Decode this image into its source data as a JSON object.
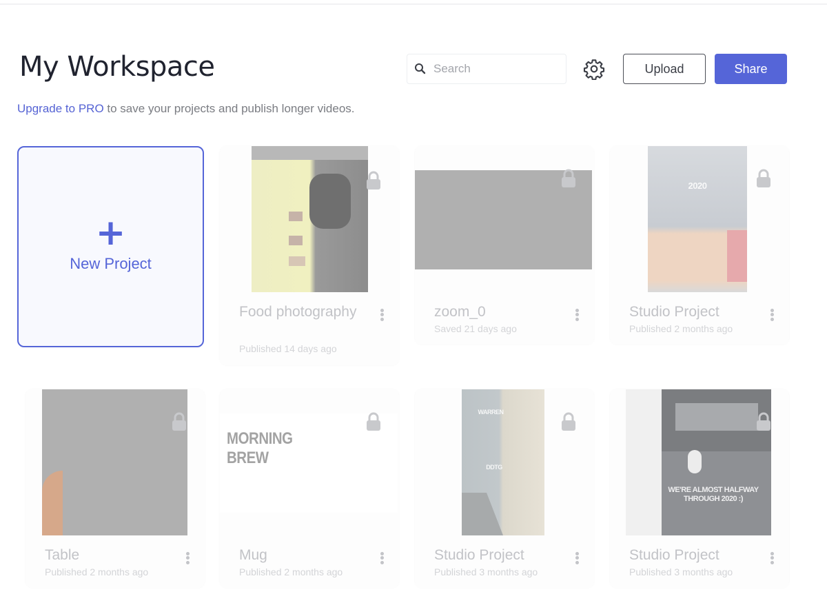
{
  "header": {
    "title": "My Workspace",
    "upgrade_link": "Upgrade to PRO",
    "upgrade_rest": " to save your projects and publish longer videos.",
    "search_placeholder": "Search",
    "search_value": "",
    "upload_label": "Upload",
    "share_label": "Share"
  },
  "colors": {
    "accent": "#5565d8",
    "title": "#20232f"
  },
  "new_project": {
    "label": "New Project",
    "icon": "plus-icon"
  },
  "projects": [
    {
      "name": "Food photography",
      "status": "Published 14 days ago",
      "locked": true,
      "thumb_caption": ""
    },
    {
      "name": "zoom_0",
      "status": "Saved 21 days ago",
      "locked": true,
      "thumb_caption": ""
    },
    {
      "name": "Studio Project",
      "status": "Published 2 months ago",
      "locked": true,
      "thumb_caption": "2020"
    },
    {
      "name": "Table",
      "status": "Published 2 months ago",
      "locked": true,
      "thumb_caption": ""
    },
    {
      "name": "Mug",
      "status": "Published 2 months ago",
      "locked": true,
      "thumb_caption": "MORNING BREW"
    },
    {
      "name": "Studio Project",
      "status": "Published 3 months ago",
      "locked": true,
      "thumb_caption": "WARREN",
      "thumb_caption2": "DDTG"
    },
    {
      "name": "Studio Project",
      "status": "Published 3 months ago",
      "locked": true,
      "thumb_caption": "WE'RE ALMOST HALFWAY THROUGH 2020 :)"
    }
  ]
}
